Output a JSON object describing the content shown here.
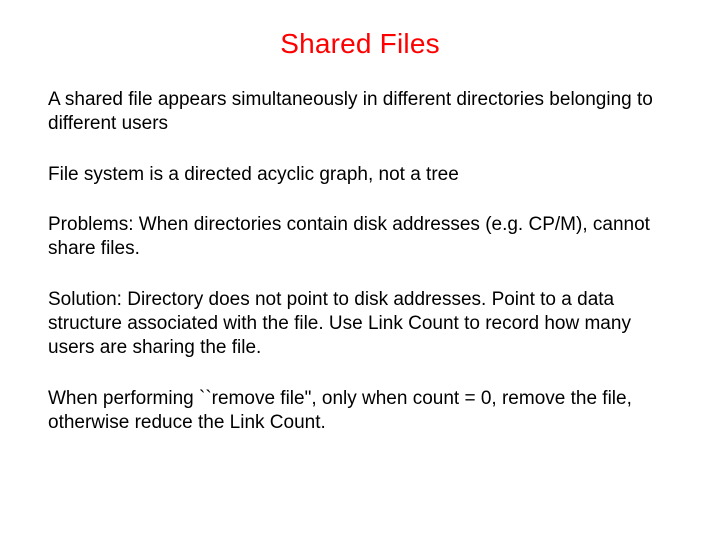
{
  "slide": {
    "title": "Shared Files",
    "paragraphs": [
      "A shared file appears simultaneously in different directories belonging to different users",
      "File system is a directed acyclic graph, not a tree",
      "Problems: When directories contain disk addresses (e.g. CP/M), cannot share files.",
      "Solution: Directory does not point to disk addresses. Point to a data structure associated with the file. Use Link Count to record how many users are sharing the file.",
      "When performing ``remove file\", only when count = 0, remove the file, otherwise reduce the Link Count."
    ]
  }
}
